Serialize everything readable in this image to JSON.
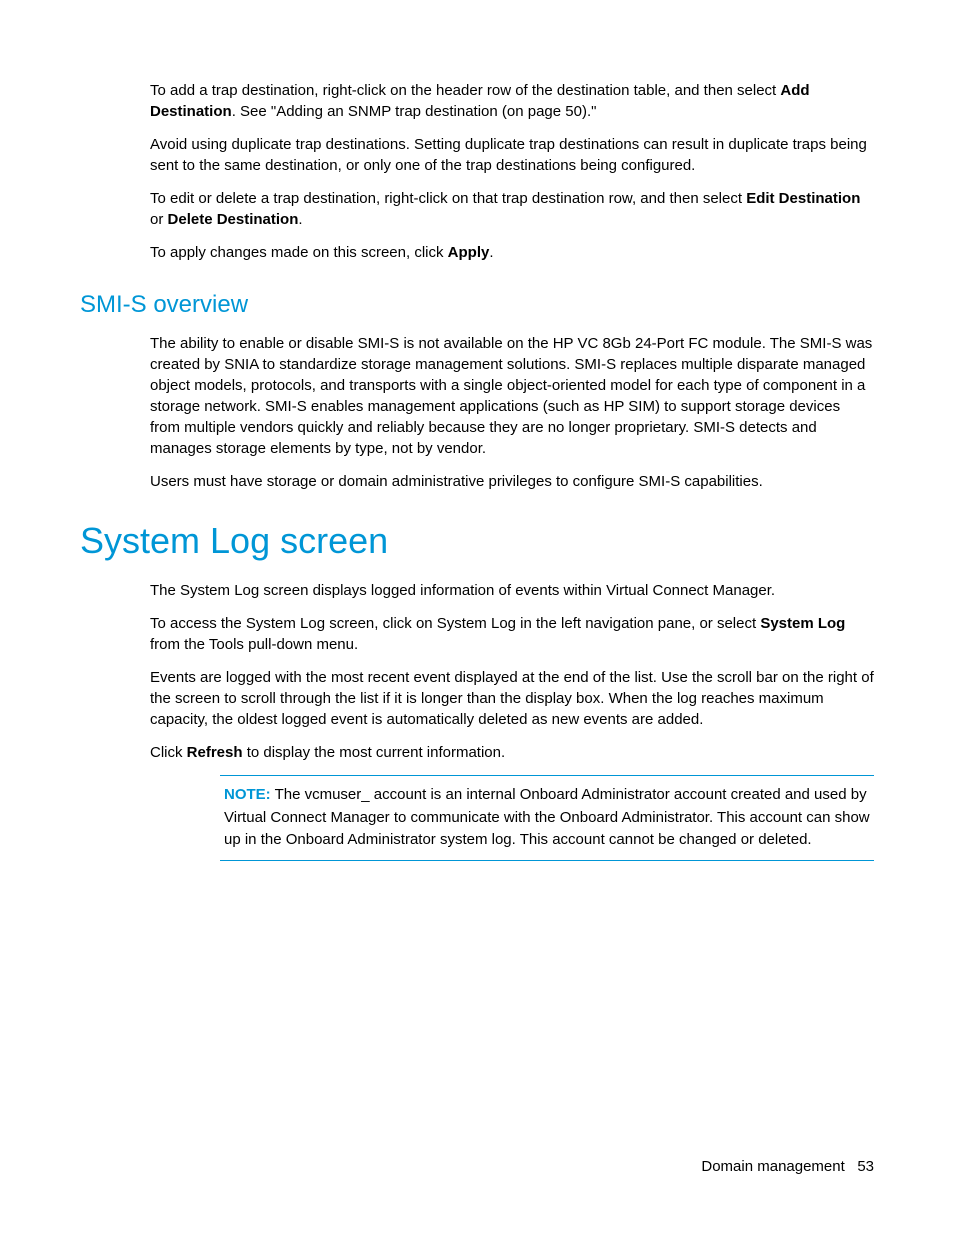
{
  "section1": {
    "p1_a": "To add a trap destination, right-click on the header row of the destination table, and then select ",
    "p1_b": "Add Destination",
    "p1_c": ". See \"Adding an SNMP trap destination (on page 50).\"",
    "p2": "Avoid using duplicate trap destinations. Setting duplicate trap destinations can result in duplicate traps being sent to the same destination, or only one of the trap destinations being configured.",
    "p3_a": "To edit or delete a trap destination, right-click on that trap destination row, and then select ",
    "p3_b": "Edit Destination",
    "p3_c": " or ",
    "p3_d": "Delete Destination",
    "p3_e": ".",
    "p4_a": "To apply changes made on this screen, click ",
    "p4_b": "Apply",
    "p4_c": "."
  },
  "smis": {
    "heading": "SMI-S overview",
    "p1": "The ability to enable or disable SMI-S is not available on the HP VC 8Gb 24-Port FC module. The SMI-S was created by SNIA to standardize storage management solutions. SMI-S replaces multiple disparate managed object models, protocols, and transports with a single object-oriented model for each type of component in a storage network. SMI-S enables management applications (such as HP SIM) to support storage devices from multiple vendors quickly and reliably because they are no longer proprietary. SMI-S detects and manages storage elements by type, not by vendor.",
    "p2": "Users must have storage or domain administrative privileges to configure SMI-S capabilities."
  },
  "syslog": {
    "heading": "System Log screen",
    "p1": "The System Log screen displays logged information of events within Virtual Connect Manager.",
    "p2_a": "To access the System Log screen, click on System Log in the left navigation pane, or select ",
    "p2_b": "System Log",
    "p2_c": " from the Tools pull-down menu.",
    "p3": "Events are logged with the most recent event displayed at the end of the list. Use the scroll bar on the right of the screen to scroll through the list if it is longer than the display box. When the log reaches maximum capacity, the oldest logged event is automatically deleted as new events are added.",
    "p4_a": "Click ",
    "p4_b": "Refresh",
    "p4_c": " to display the most current information.",
    "note_label": "NOTE:",
    "note_text": "  The vcmuser_ account is an internal Onboard Administrator account created and used by Virtual Connect Manager to communicate with the Onboard Administrator. This account can show up in the Onboard Administrator system log. This account cannot be changed or deleted."
  },
  "footer": {
    "section": "Domain management",
    "page": "53"
  }
}
